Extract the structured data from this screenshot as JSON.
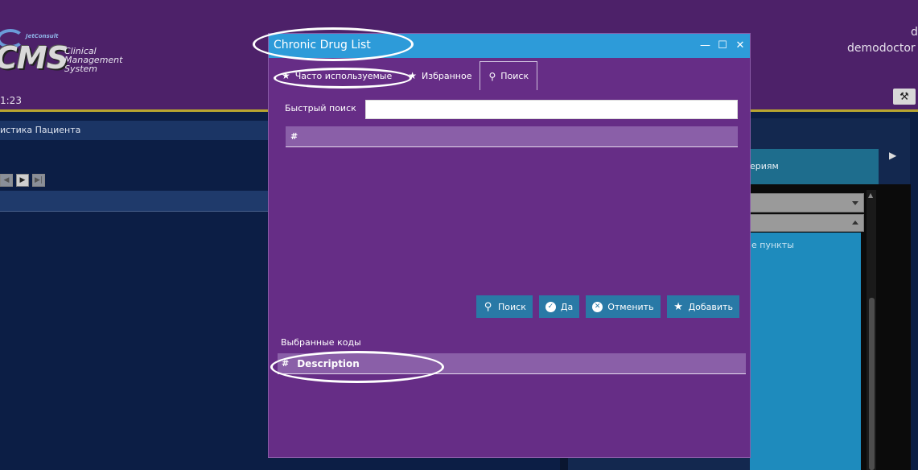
{
  "app": {
    "logo_small": "JetConsult",
    "logo_cms": "CMS",
    "logo_text_1": "Clinical",
    "logo_text_2": "Management",
    "logo_text_3": "System",
    "clock": "1:23",
    "user_initial": "d",
    "username": "demodoctor",
    "left_panel_title": "истика Пациента",
    "right_panel_header": "ериям",
    "right_panel_text": "е пункты"
  },
  "dialog": {
    "title": "Chronic Drug List",
    "controls": {
      "minimize": "—",
      "maximize": "☐",
      "close": "✕"
    },
    "tabs": [
      {
        "label": "Часто используемые",
        "icon": "star-icon"
      },
      {
        "label": "Избранное",
        "icon": "star-icon"
      },
      {
        "label": "Поиск",
        "icon": "search-icon",
        "active": true
      }
    ],
    "quick_search": {
      "label": "Быстрый поиск",
      "value": ""
    },
    "results_grid": {
      "col_hash": "#"
    },
    "buttons": {
      "search": "Поиск",
      "ok": "Да",
      "cancel": "Отменить",
      "add": "Добавить"
    },
    "selected": {
      "label": "Выбранные коды",
      "col_hash": "#",
      "col_description": "Description"
    }
  },
  "colors": {
    "dialog_bg": "#662d86",
    "titlebar": "#2d9bd9",
    "button": "#2979a6",
    "grid_header": "#8a5fa8"
  }
}
